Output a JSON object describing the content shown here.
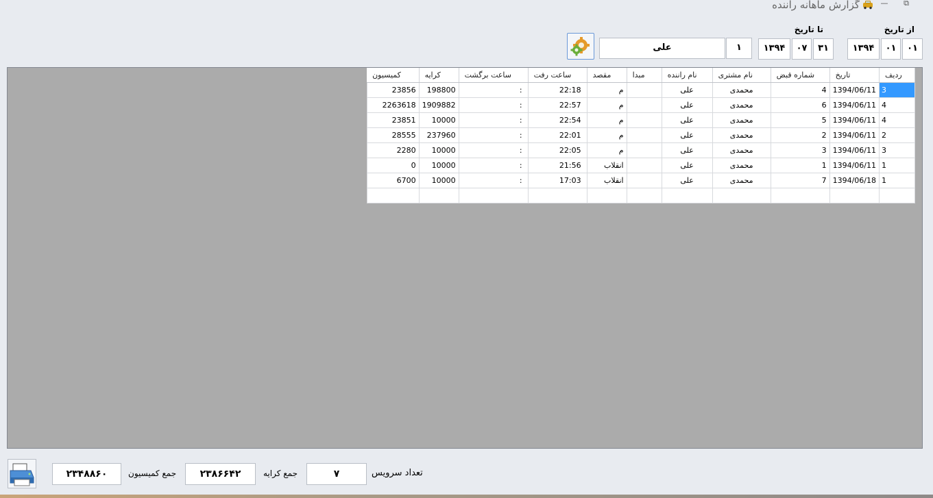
{
  "window": {
    "title": "گزارش ماهانه راننده",
    "restore_symbol": "⧉",
    "minimize_symbol": "—"
  },
  "filter": {
    "from_label": "از تاریخ",
    "to_label": "تا تاریخ",
    "from_day": "۰۱",
    "from_month": "۰۱",
    "from_year": "۱۳۹۴",
    "to_day": "۳۱",
    "to_month": "۰۷",
    "to_year": "۱۳۹۴",
    "driver_code": "۱",
    "driver_name": "علی"
  },
  "table": {
    "headers": [
      "ردیف",
      "تاریخ",
      "شماره قبض",
      "نام مشتری",
      "نام راننده",
      "مبدا",
      "مقصد",
      "ساعت رفت",
      "ساعت برگشت",
      "کرایه",
      "کمیسیون"
    ],
    "rows": [
      {
        "row": "3",
        "date": "1394/06/11",
        "receipt": "4",
        "customer": "محمدی",
        "driver": "علی",
        "origin": "",
        "dest": "م",
        "depart": "22:18",
        "return": ":",
        "fare": "198800",
        "commission": "23856"
      },
      {
        "row": "4",
        "date": "1394/06/11",
        "receipt": "6",
        "customer": "محمدی",
        "driver": "علی",
        "origin": "",
        "dest": "م",
        "depart": "22:57",
        "return": ":",
        "fare": "1909882",
        "commission": "2263618"
      },
      {
        "row": "4",
        "date": "1394/06/11",
        "receipt": "5",
        "customer": "محمدی",
        "driver": "علی",
        "origin": "",
        "dest": "م",
        "depart": "22:54",
        "return": ":",
        "fare": "10000",
        "commission": "23851"
      },
      {
        "row": "2",
        "date": "1394/06/11",
        "receipt": "2",
        "customer": "محمدی",
        "driver": "علی",
        "origin": "",
        "dest": "م",
        "depart": "22:01",
        "return": ":",
        "fare": "237960",
        "commission": "28555"
      },
      {
        "row": "3",
        "date": "1394/06/11",
        "receipt": "3",
        "customer": "محمدی",
        "driver": "علی",
        "origin": "",
        "dest": "م",
        "depart": "22:05",
        "return": ":",
        "fare": "10000",
        "commission": "2280"
      },
      {
        "row": "1",
        "date": "1394/06/11",
        "receipt": "1",
        "customer": "محمدی",
        "driver": "علی",
        "origin": "",
        "dest": "انقلاب",
        "depart": "21:56",
        "return": ":",
        "fare": "10000",
        "commission": "0"
      },
      {
        "row": "1",
        "date": "1394/06/18",
        "receipt": "7",
        "customer": "محمدی",
        "driver": "علی",
        "origin": "",
        "dest": "انقلاب",
        "depart": "17:03",
        "return": ":",
        "fare": "10000",
        "commission": "6700"
      }
    ]
  },
  "summary": {
    "service_count_label": "تعداد سرویس",
    "service_count": "۷",
    "fare_total_label": "جمع کرایه",
    "fare_total": "۲۳۸۶۶۴۲",
    "commission_total_label": "جمع کمیسیون",
    "commission_total": "۲۳۴۸۸۶۰"
  }
}
